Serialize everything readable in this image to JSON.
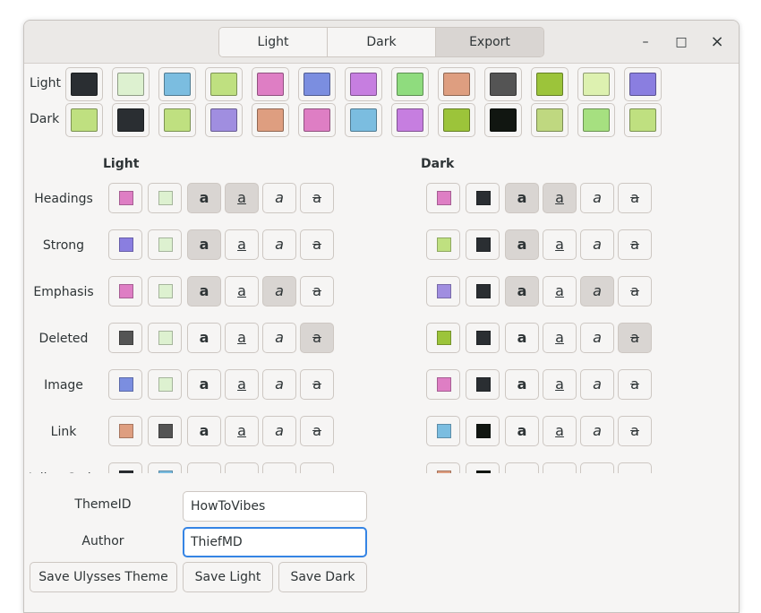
{
  "tabs": [
    {
      "label": "Light",
      "active": false
    },
    {
      "label": "Dark",
      "active": false
    },
    {
      "label": "Export",
      "active": true
    }
  ],
  "window_controls": {
    "minimize": "–",
    "maximize": "□",
    "close": "×"
  },
  "palette": {
    "light": {
      "label": "Light",
      "colors": [
        "#2a2e32",
        "#ddf1d0",
        "#7bbde0",
        "#bfe080",
        "#de7ec4",
        "#7b8ee0",
        "#c67ee0",
        "#8fdc7e",
        "#de9e80",
        "#545454",
        "#9cc43a",
        "#ddf1b0",
        "#8a7ee0"
      ]
    },
    "dark": {
      "label": "Dark",
      "colors": [
        "#bfe080",
        "#2a2e32",
        "#bfe080",
        "#a08ee0",
        "#de9e80",
        "#de7ec4",
        "#7bbde0",
        "#c67ee0",
        "#9cc43a",
        "#111611",
        "#bfd880",
        "#a6e080",
        "#bfe080"
      ]
    }
  },
  "columns": {
    "light": "Light",
    "dark": "Dark"
  },
  "glyph": "a",
  "strike_glyph": "a",
  "styles": [
    {
      "name": "Headings",
      "light": {
        "fg": "#de7ec4",
        "bg": "#ddf1d0",
        "bold": true,
        "underline": true,
        "italic": false,
        "strike": false
      },
      "dark": {
        "fg": "#de7ec4",
        "bg": "#2a2e32",
        "bold": true,
        "underline": true,
        "italic": false,
        "strike": false
      }
    },
    {
      "name": "Strong",
      "light": {
        "fg": "#8a7ee0",
        "bg": "#ddf1d0",
        "bold": true,
        "underline": false,
        "italic": false,
        "strike": false
      },
      "dark": {
        "fg": "#bfe080",
        "bg": "#2a2e32",
        "bold": true,
        "underline": false,
        "italic": false,
        "strike": false
      }
    },
    {
      "name": "Emphasis",
      "light": {
        "fg": "#de7ec4",
        "bg": "#ddf1d0",
        "bold": true,
        "underline": false,
        "italic": true,
        "strike": false
      },
      "dark": {
        "fg": "#a08ee0",
        "bg": "#2a2e32",
        "bold": true,
        "underline": false,
        "italic": true,
        "strike": false
      }
    },
    {
      "name": "Deleted",
      "light": {
        "fg": "#545454",
        "bg": "#ddf1d0",
        "bold": false,
        "underline": false,
        "italic": false,
        "strike": true
      },
      "dark": {
        "fg": "#9cc43a",
        "bg": "#2a2e32",
        "bold": false,
        "underline": false,
        "italic": false,
        "strike": true
      }
    },
    {
      "name": "Image",
      "light": {
        "fg": "#7b8ee0",
        "bg": "#ddf1d0",
        "bold": false,
        "underline": false,
        "italic": false,
        "strike": false
      },
      "dark": {
        "fg": "#de7ec4",
        "bg": "#2a2e32",
        "bold": false,
        "underline": false,
        "italic": false,
        "strike": false
      }
    },
    {
      "name": "Link",
      "light": {
        "fg": "#de9e80",
        "bg": "#545454",
        "bold": false,
        "underline": false,
        "italic": false,
        "strike": false
      },
      "dark": {
        "fg": "#7bbde0",
        "bg": "#111611",
        "bold": false,
        "underline": false,
        "italic": false,
        "strike": false
      }
    },
    {
      "name": "Inline Code",
      "light": {
        "fg": "#2a2e32",
        "bg": "#7bbde0",
        "bold": false,
        "underline": false,
        "italic": false,
        "strike": false
      },
      "dark": {
        "fg": "#de9e80",
        "bg": "#111611",
        "bold": false,
        "underline": false,
        "italic": false,
        "strike": false
      }
    }
  ],
  "form": {
    "theme_id_label": "ThemeID",
    "theme_id_value": "HowToVibes",
    "author_label": "Author",
    "author_value": "ThiefMD"
  },
  "buttons": {
    "save_ulysses": "Save Ulysses Theme",
    "save_light": "Save Light",
    "save_dark": "Save Dark"
  },
  "colors": {
    "focus": "#3584e4",
    "toggle_on": "#d9d5d2",
    "window_bg": "#f6f5f4"
  }
}
